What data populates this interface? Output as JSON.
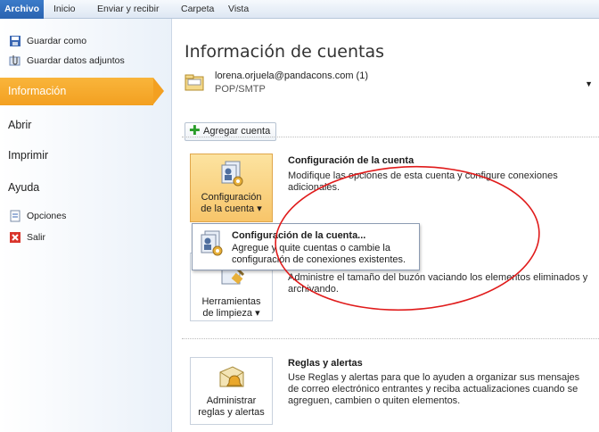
{
  "ribbon": {
    "tabs": [
      "Archivo",
      "Inicio",
      "Enviar y recibir",
      "Carpeta",
      "Vista"
    ]
  },
  "sidebar": {
    "save_as": "Guardar como",
    "save_attachments": "Guardar datos adjuntos",
    "selected": "Información",
    "open": "Abrir",
    "print": "Imprimir",
    "help": "Ayuda",
    "options": "Opciones",
    "exit": "Salir"
  },
  "main": {
    "title": "Información de cuentas",
    "account_email": "lorena.orjuela@pandacons.com (1)",
    "account_type": "POP/SMTP",
    "add_account": "Agregar cuenta",
    "sections": [
      {
        "button_label": "Configuración de la cuenta ▾",
        "heading": "Configuración de la cuenta",
        "description": "Modifique las opciones de esta cuenta y configure conexiones adicionales."
      },
      {
        "button_label": "Herramientas de limpieza ▾",
        "heading": "",
        "description": "Administre el tamaño del buzón vaciando los elementos eliminados y archivando."
      },
      {
        "button_label": "Administrar reglas y alertas",
        "heading": "Reglas y alertas",
        "description": "Use Reglas y alertas para que lo ayuden a organizar sus mensajes de correo electrónico entrantes y reciba actualizaciones cuando se agreguen, cambien o quiten elementos."
      }
    ],
    "popup": {
      "title": "Configuración de la cuenta...",
      "description": "Agregue y quite cuentas o cambie la configuración de conexiones existentes."
    }
  },
  "colors": {
    "accent": "#f3a021",
    "file_tab": "#2a63b0",
    "annotation": "#e01b1b"
  }
}
